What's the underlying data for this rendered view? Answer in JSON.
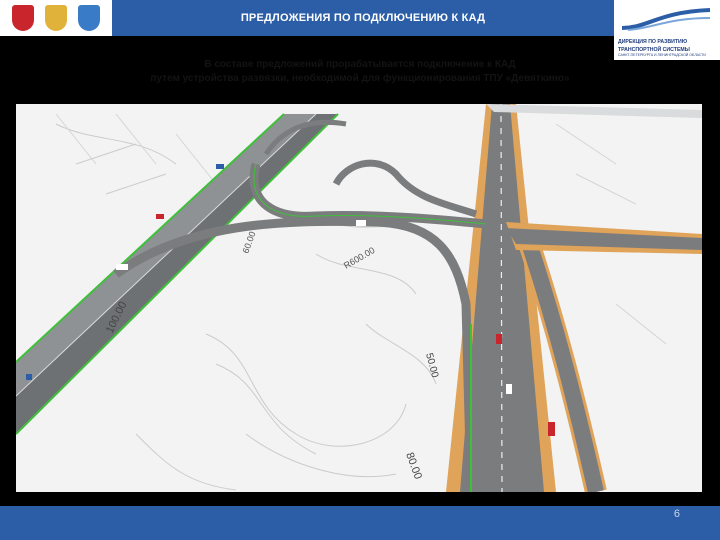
{
  "header": {
    "title": "ПРЕДЛОЖЕНИЯ ПО ПОДКЛЮЧЕНИЮ К КАД",
    "left_logos": [
      "spb-emblem-icon",
      "russia-emblem-icon",
      "leningrad-oblast-emblem-icon"
    ],
    "right_logo": {
      "line1": "ДИРЕКЦИЯ ПО РАЗВИТИЮ",
      "line2": "ТРАНСПОРТНОЙ СИСТЕМЫ",
      "line3": "САНКТ-ПЕТЕРБУРГА И ЛЕНИНГРАДСКОЙ ОБЛАСТИ"
    }
  },
  "subtitle": {
    "line1": "В составе предложений прорабатывается подключение к КАД",
    "line2": "путем устройства развязки, необходимой для функционирования ТПУ «Девяткино»"
  },
  "map": {
    "labels": [
      "100.00",
      "80.00",
      "60.00",
      "50.00",
      "R600.00"
    ]
  },
  "footer": {
    "page_number": "6"
  },
  "colors": {
    "brand_blue": "#2b5ea7",
    "road_gray": "#7a7c7d",
    "road_edge_orange": "#e0a35a",
    "green_edge": "#3fc03a"
  }
}
